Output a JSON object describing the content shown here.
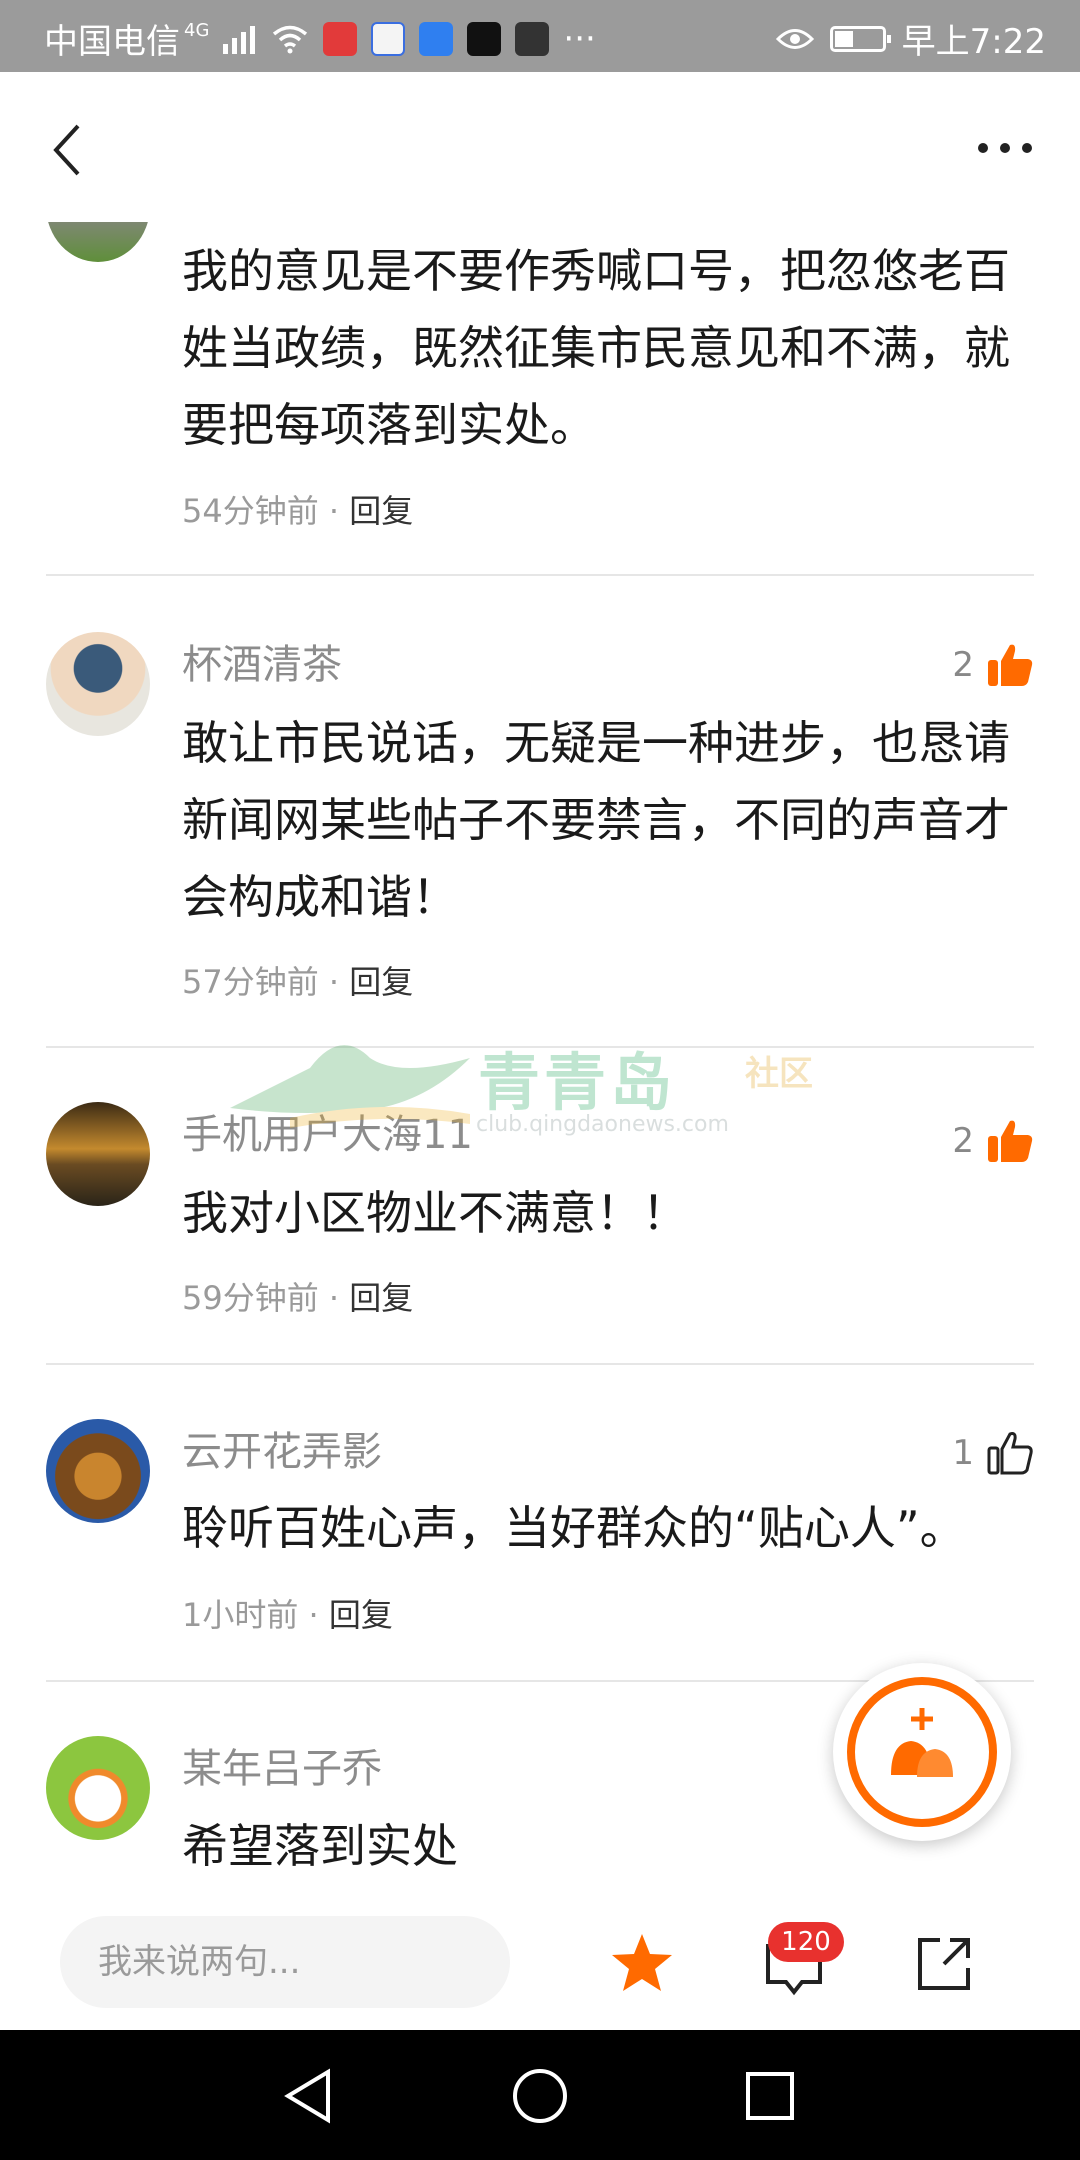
{
  "status_bar": {
    "carrier": "中国电信",
    "network": "4G",
    "time": "早上7:22",
    "more": "···"
  },
  "colors": {
    "accent": "#ff6a00",
    "badge": "#e8312e",
    "status_bar_bg": "#9b9b9b"
  },
  "comments": [
    {
      "author": "",
      "text": "我的意见是不要作秀喊口号，把忽悠老百姓当政绩，既然征集市民意见和不满，就要把每项落到实处。",
      "time": "54分钟前",
      "sep": "·",
      "reply": "回复"
    },
    {
      "author": "杯酒清茶",
      "text": "敢让市民说话，无疑是一种进步，也恳请新闻网某些帖子不要禁言，不同的声音才会构成和谐！",
      "time": "57分钟前",
      "sep": "·",
      "reply": "回复",
      "likes": "2",
      "liked": true
    },
    {
      "author": "手机用户大海11",
      "text": "我对小区物业不满意！！",
      "time": "59分钟前",
      "sep": "·",
      "reply": "回复",
      "likes": "2",
      "liked": true
    },
    {
      "author": "云开花弄影",
      "text": "聆听百姓心声，当好群众的“贴心人”。",
      "time": "1小时前",
      "sep": "·",
      "reply": "回复",
      "likes": "1",
      "liked": false
    },
    {
      "author": "某年吕子乔",
      "text": "希望落到实处"
    }
  ],
  "watermark": {
    "title": "青青岛",
    "tag": "社区",
    "url": "club.qingdaonews.com"
  },
  "bottom_bar": {
    "input_placeholder": "我来说两句...",
    "comment_count": "120"
  }
}
